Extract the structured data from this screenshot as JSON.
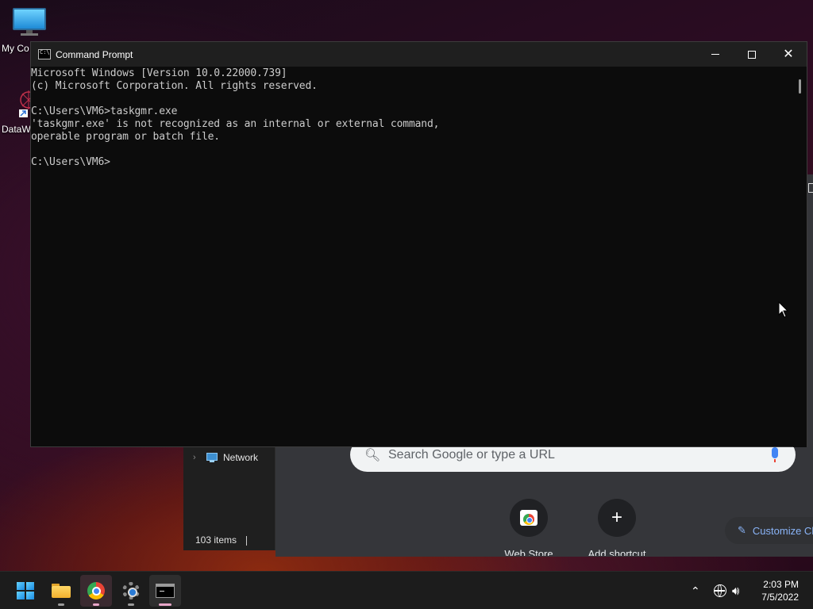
{
  "desktop": {
    "icons": [
      {
        "label": "My Co"
      },
      {
        "label": "DataW"
      }
    ]
  },
  "cmd_window": {
    "title": "Command Prompt",
    "lines": [
      "Microsoft Windows [Version 10.0.22000.739]",
      "(c) Microsoft Corporation. All rights reserved.",
      "",
      "C:\\Users\\VM6>taskgmr.exe",
      "'taskgmr.exe' is not recognized as an internal or external command,",
      "operable program or batch file.",
      "",
      "C:\\Users\\VM6>"
    ]
  },
  "explorer": {
    "nav_item": "Network",
    "status": "103 items"
  },
  "chrome_newtab": {
    "search_placeholder": "Search Google or type a URL",
    "shortcuts": [
      {
        "label": "Web Store",
        "icon": "web-store-icon"
      },
      {
        "label": "Add shortcut",
        "icon": "plus-icon"
      }
    ],
    "customize_label": "Customize Chrome"
  },
  "taskbar": {
    "apps": [
      {
        "name": "start",
        "icon": "windows-logo-icon"
      },
      {
        "name": "file-explorer",
        "icon": "folder-icon"
      },
      {
        "name": "chrome",
        "icon": "chrome-icon"
      },
      {
        "name": "settings",
        "icon": "gear-icon"
      },
      {
        "name": "command-prompt",
        "icon": "terminal-icon"
      }
    ],
    "clock": {
      "time": "2:03 PM",
      "date": "7/5/2022"
    }
  },
  "colors": {
    "console_bg": "#0c0c0c",
    "console_text": "#cccccc",
    "titlebar": "#1f1f1f",
    "taskbar": "#1c1c1c",
    "chrome_link": "#8ab4f8"
  }
}
